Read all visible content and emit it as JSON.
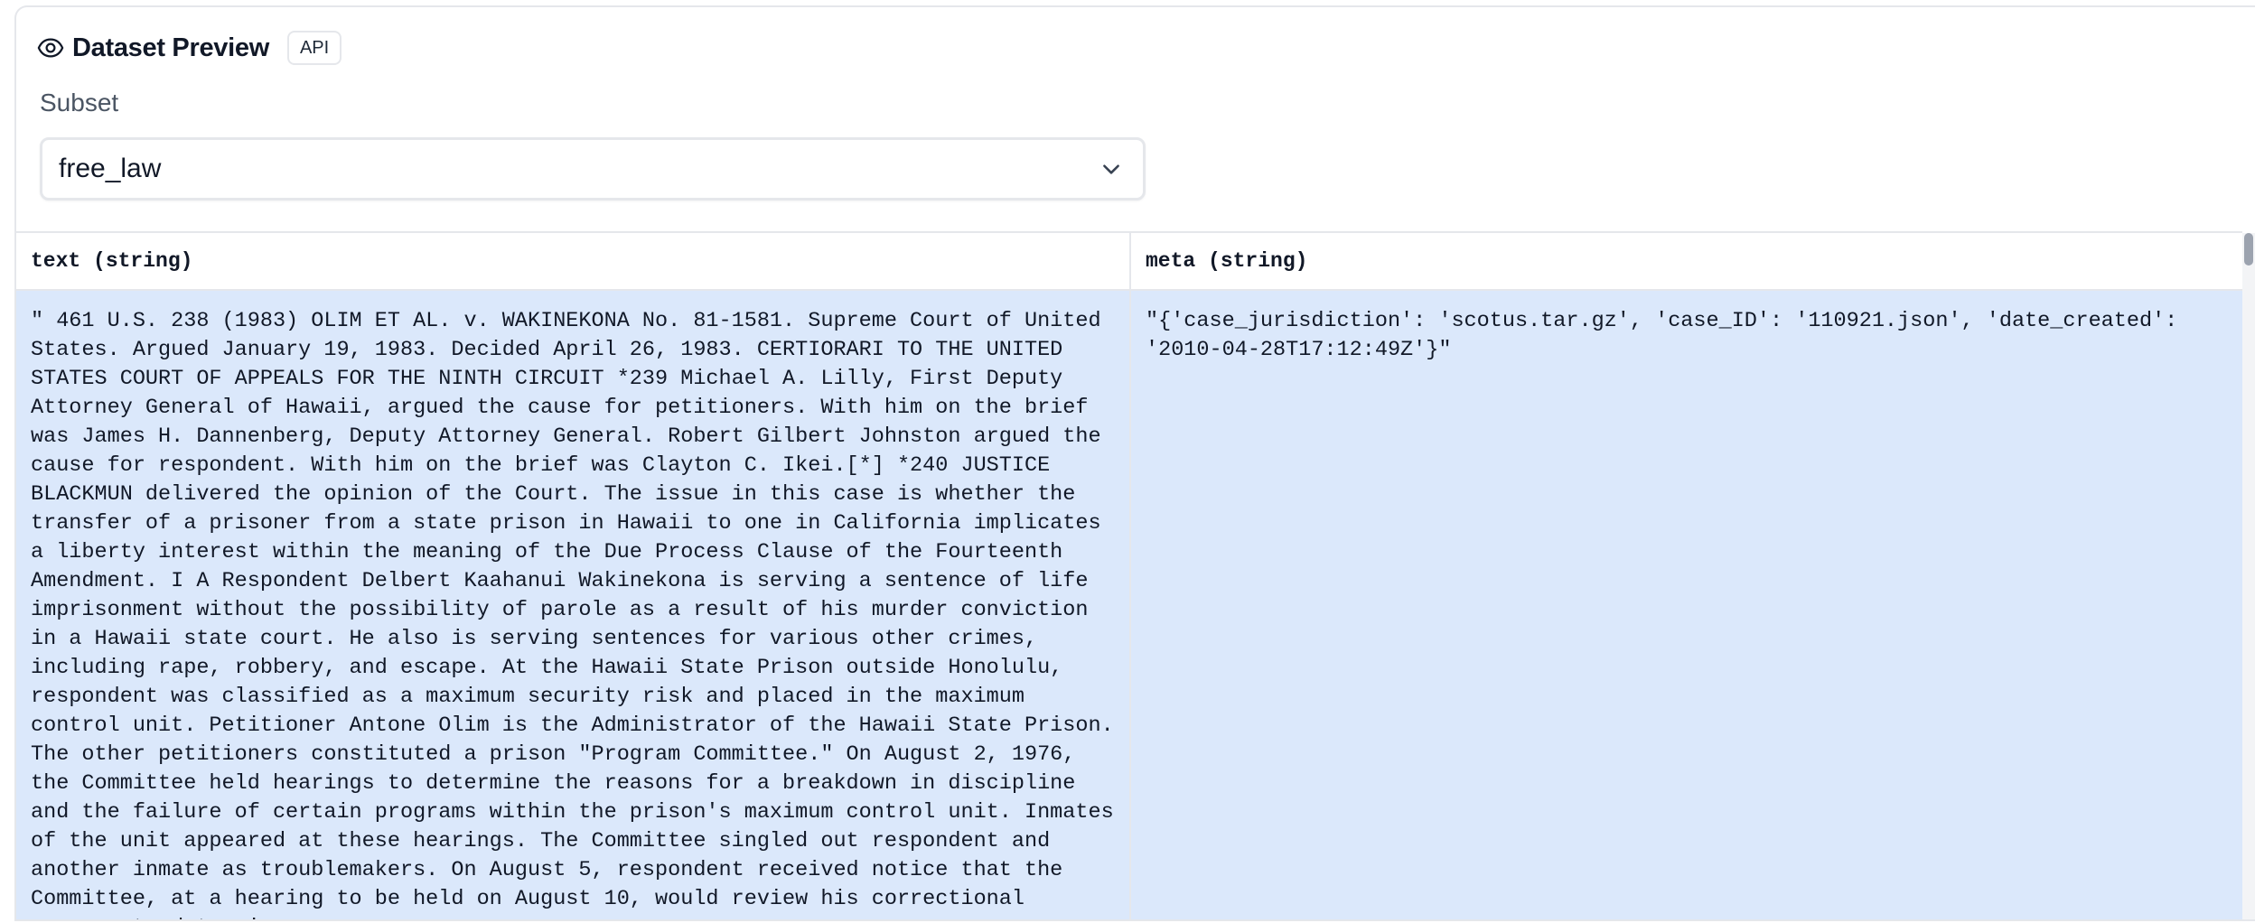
{
  "header": {
    "icon": "eye-icon",
    "title": "Dataset Preview",
    "api_badge": "API"
  },
  "subset": {
    "label": "Subset",
    "selected": "free_law",
    "icon": "chevron-down-icon"
  },
  "table": {
    "columns": [
      "text (string)",
      "meta (string)"
    ],
    "rows": [
      {
        "text": "\" 461 U.S. 238 (1983) OLIM ET AL. v. WAKINEKONA No. 81-1581. Supreme Court of United States. Argued January 19, 1983. Decided April 26, 1983. CERTIORARI TO THE UNITED STATES COURT OF APPEALS FOR THE NINTH CIRCUIT *239 Michael A. Lilly, First Deputy Attorney General of Hawaii, argued the cause for petitioners. With him on the brief was James H. Dannenberg, Deputy Attorney General. Robert Gilbert Johnston argued the cause for respondent. With him on the brief was Clayton C. Ikei.[*] *240 JUSTICE BLACKMUN delivered the opinion of the Court. The issue in this case is whether the transfer of a prisoner from a state prison in Hawaii to one in California implicates a liberty interest within the meaning of the Due Process Clause of the Fourteenth Amendment. I A Respondent Delbert Kaahanui Wakinekona is serving a sentence of life imprisonment without the possibility of parole as a result of his murder conviction in a Hawaii state court. He also is serving sentences for various other crimes, including rape, robbery, and escape. At the Hawaii State Prison outside Honolulu, respondent was classified as a maximum security risk and placed in the maximum control unit. Petitioner Antone Olim is the Administrator of the Hawaii State Prison. The other petitioners constituted a prison \"Program Committee.\" On August 2, 1976, the Committee held hearings to determine the reasons for a breakdown in discipline and the failure of certain programs within the prison's maximum control unit. Inmates of the unit appeared at these hearings. The Committee singled out respondent and another inmate as troublemakers. On August 5, respondent received notice that the Committee, at a hearing to be held on August 10, would review his correctional program to determine",
        "meta": "\"{'case_jurisdiction': 'scotus.tar.gz', 'case_ID': '110921.json', 'date_created': '2010-04-28T17:12:49Z'}\""
      }
    ]
  },
  "colors": {
    "selected_row": "#dbe8fb",
    "border": "#e5e7eb"
  }
}
